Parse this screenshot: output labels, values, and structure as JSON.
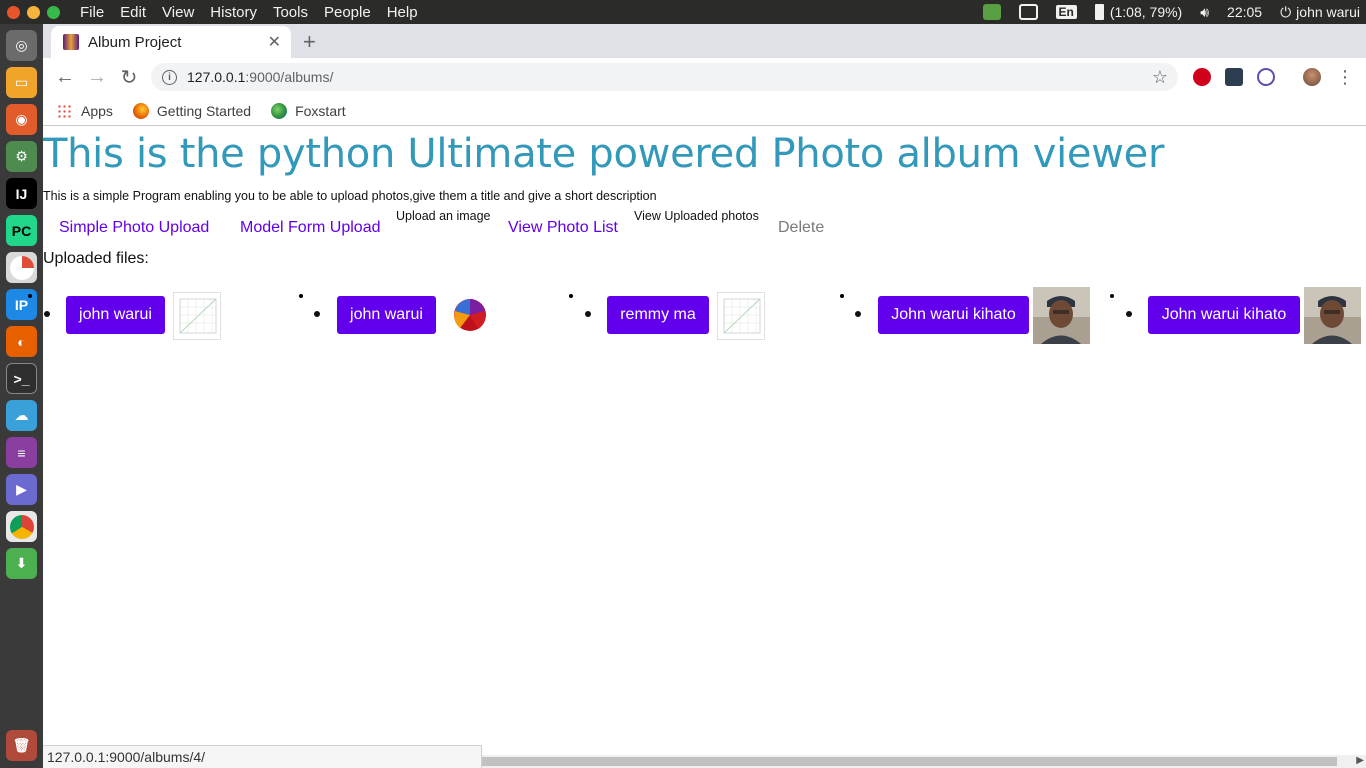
{
  "os": {
    "menu": [
      "File",
      "Edit",
      "View",
      "History",
      "Tools",
      "People",
      "Help"
    ],
    "keyboard_layout": "En",
    "battery": "(1:08, 79%)",
    "time": "22:05",
    "user": "john warui"
  },
  "browser": {
    "tab_title": "Album Project",
    "url_host": "127.0.0.1",
    "url_rest": ":9000/albums/",
    "bookmarks": [
      "Apps",
      "Getting Started",
      "Foxstart"
    ],
    "status_url": "127.0.0.1:9000/albums/4/"
  },
  "page": {
    "title": "This is the python Ultimate powered Photo album viewer",
    "description": "This is a simple Program enabling you to be able to upload photos,give them a title and give a short description",
    "nav": {
      "simple_upload": "Simple Photo Upload",
      "model_form_upload": "Model Form Upload",
      "upload_hint": "Upload an image",
      "view_list": "View Photo List",
      "view_hint": "View Uploaded photos",
      "delete": "Delete"
    },
    "uploaded_label": "Uploaded files:",
    "files": [
      {
        "title": "john warui",
        "thumb": "line-chart"
      },
      {
        "title": "john warui",
        "thumb": "pie-chart"
      },
      {
        "title": "remmy ma",
        "thumb": "line-chart"
      },
      {
        "title": "John warui kihato",
        "thumb": "portrait-photo"
      },
      {
        "title": "John warui kihato",
        "thumb": "portrait-photo"
      }
    ]
  },
  "colors": {
    "title": "#3399bb",
    "link": "#6200ee",
    "button_bg": "#6200ee"
  }
}
